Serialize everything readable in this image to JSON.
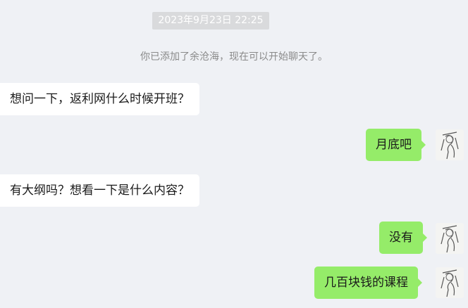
{
  "chat": {
    "timestamp": "2023年9月23日 22:25",
    "system_note": "你已添加了余沧海，现在可以开始聊天了。",
    "messages": [
      {
        "side": "in",
        "text": "想问一下，返利网什么时候开班？"
      },
      {
        "side": "out",
        "text": "月底吧"
      },
      {
        "side": "in",
        "text": "有大纲吗？想看一下是什么内容？"
      },
      {
        "side": "out",
        "text": "没有"
      },
      {
        "side": "out",
        "text": "几百块钱的课程"
      }
    ]
  },
  "icons": {
    "avatar": "sketch-portrait-avatar"
  },
  "colors": {
    "background": "#eff1f5",
    "outgoing_bubble": "#95ec69",
    "incoming_bubble": "#ffffff"
  }
}
